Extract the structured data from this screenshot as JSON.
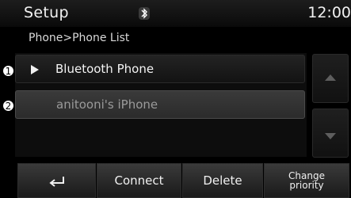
{
  "header": {
    "title": "Setup",
    "clock": "12:00",
    "status_icon": "bluetooth-icon"
  },
  "breadcrumb": "Phone>Phone List",
  "list": {
    "items": [
      {
        "callout": "1",
        "label": "Bluetooth Phone",
        "active": true,
        "icon": "play-icon"
      },
      {
        "callout": "2",
        "label": "anitooni's iPhone",
        "active": false
      }
    ]
  },
  "scroll": {
    "up_icon": "chevron-up-icon",
    "down_icon": "chevron-down-icon"
  },
  "bottom_bar": {
    "back_icon": "back-arrow-icon",
    "connect_label": "Connect",
    "delete_label": "Delete",
    "change_priority_line1": "Change",
    "change_priority_line2": "priority"
  },
  "colors": {
    "background": "#000000",
    "text": "#f0f0f0",
    "inactive_text": "#9a9a9a"
  }
}
